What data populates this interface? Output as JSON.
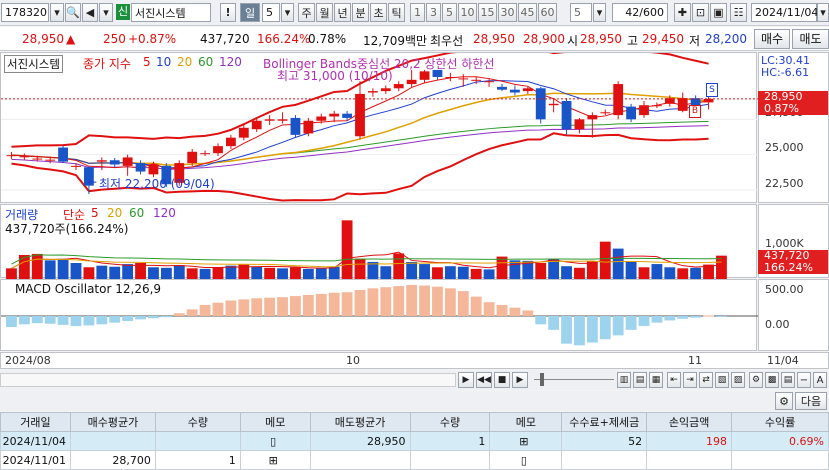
{
  "toolbar": {
    "code": "178320",
    "badge": "신",
    "name": "서진시스템",
    "excl": "!",
    "tf_sel": "일",
    "tf_num": "5",
    "tabs": [
      "주",
      "월",
      "년",
      "분",
      "초",
      "틱"
    ],
    "mins": [
      "1",
      "3",
      "5",
      "10",
      "15",
      "30",
      "45",
      "60"
    ],
    "min_val": "5",
    "count": "42/600",
    "date": "2024/11/04"
  },
  "quote": {
    "price": "28,950",
    "arrow": "▲",
    "change": "250",
    "rate": "+0.87%",
    "volume": "437,720",
    "vol_rate": "166.24%",
    "turnover": "0.78%",
    "amount": "12,709백만",
    "label_pri": "최우선",
    "ask": "28,950",
    "bid": "28,900",
    "open_lbl": "시",
    "open": "28,950",
    "high_lbl": "고",
    "high": "29,450",
    "low_lbl": "저",
    "low": "28,200",
    "buy": "매수",
    "sell": "매도"
  },
  "price_chart": {
    "name_tag": "서진시스템",
    "ma_title": "종가 지수",
    "ma_periods": [
      "5",
      "10",
      "20",
      "60",
      "120"
    ],
    "ma_colors": [
      "#e01010",
      "#2040d0",
      "#e0a000",
      "#2a9a2a",
      "#9030c0"
    ],
    "bb_text": "Bollinger Bands중심선 20,2  상한선  하한선",
    "max_note": "최고 31,000 (10/10)",
    "min_note": "최저 22,200 (09/04)",
    "lc": "LC:30.41",
    "hc": "HC:-6.61",
    "cur_price": "28,950",
    "cur_rate": "0.87%",
    "y_ticks": [
      "27,500",
      "25,000",
      "22,500"
    ]
  },
  "volume_chart": {
    "title": "거래량",
    "ma_title": "단순",
    "ma_periods": [
      "5",
      "20",
      "60",
      "120"
    ],
    "ma_colors": [
      "#e01010",
      "#e0a000",
      "#2a9a2a",
      "#9030c0"
    ],
    "sub": "437,720주(166.24%)",
    "y_tick": "1,000K",
    "cur": "437,720",
    "cur_rate": "166.24%"
  },
  "macd": {
    "title": "MACD Oscillator 12,26,9",
    "y_ticks": [
      "500.00",
      "0.00"
    ]
  },
  "date_axis": {
    "left": "2024/08",
    "mid": "10",
    "right": "11",
    "end": "11/04"
  },
  "chart_data": {
    "type": "candlestick",
    "candles": [
      {
        "o": 24960,
        "c": 24960,
        "h": 25180,
        "l": 24700
      },
      {
        "o": 24880,
        "c": 24880,
        "h": 25080,
        "l": 24620
      },
      {
        "o": 24720,
        "c": 24720,
        "h": 24920,
        "l": 24520
      },
      {
        "o": 24640,
        "c": 24640,
        "h": 24860,
        "l": 24380
      },
      {
        "o": 25500,
        "c": 24500,
        "h": 25640,
        "l": 24400
      },
      {
        "o": 24200,
        "c": 24200,
        "h": 24400,
        "l": 23900
      },
      {
        "o": 24100,
        "c": 22800,
        "h": 24200,
        "l": 22200
      },
      {
        "o": 24500,
        "c": 24600,
        "h": 24800,
        "l": 23900
      },
      {
        "o": 24600,
        "c": 24300,
        "h": 24760,
        "l": 24100
      },
      {
        "o": 24200,
        "c": 24800,
        "h": 25000,
        "l": 23500
      },
      {
        "o": 24400,
        "c": 23800,
        "h": 24600,
        "l": 23600
      },
      {
        "o": 23600,
        "c": 24300,
        "h": 24500,
        "l": 23400
      },
      {
        "o": 24200,
        "c": 22900,
        "h": 24400,
        "l": 22700
      },
      {
        "o": 23000,
        "c": 24400,
        "h": 24600,
        "l": 22800
      },
      {
        "o": 24400,
        "c": 25200,
        "h": 25400,
        "l": 24200
      },
      {
        "o": 25100,
        "c": 25100,
        "h": 25300,
        "l": 24900
      },
      {
        "o": 25100,
        "c": 25600,
        "h": 25800,
        "l": 24900
      },
      {
        "o": 25600,
        "c": 26200,
        "h": 26400,
        "l": 25400
      },
      {
        "o": 26200,
        "c": 26900,
        "h": 27100,
        "l": 26000
      },
      {
        "o": 26800,
        "c": 27400,
        "h": 27600,
        "l": 26600
      },
      {
        "o": 27400,
        "c": 27500,
        "h": 27800,
        "l": 27100
      },
      {
        "o": 27400,
        "c": 27500,
        "h": 28000,
        "l": 27200
      },
      {
        "o": 27600,
        "c": 26400,
        "h": 27800,
        "l": 26200
      },
      {
        "o": 26500,
        "c": 27400,
        "h": 27600,
        "l": 26300
      },
      {
        "o": 27400,
        "c": 27700,
        "h": 27900,
        "l": 27200
      },
      {
        "o": 27700,
        "c": 27900,
        "h": 28100,
        "l": 27300
      },
      {
        "o": 27900,
        "c": 27600,
        "h": 28100,
        "l": 27400
      },
      {
        "o": 26300,
        "c": 29300,
        "h": 30200,
        "l": 26100
      },
      {
        "o": 29400,
        "c": 29500,
        "h": 29700,
        "l": 29100
      },
      {
        "o": 29500,
        "c": 29700,
        "h": 29900,
        "l": 29300
      },
      {
        "o": 29700,
        "c": 30000,
        "h": 30200,
        "l": 29500
      },
      {
        "o": 30000,
        "c": 30300,
        "h": 31000,
        "l": 29800
      },
      {
        "o": 30300,
        "c": 30900,
        "h": 31000,
        "l": 30100
      },
      {
        "o": 31000,
        "c": 30500,
        "h": 31000,
        "l": 30300
      },
      {
        "o": 30500,
        "c": 30500,
        "h": 30800,
        "l": 30200
      },
      {
        "o": 30400,
        "c": 30400,
        "h": 30700,
        "l": 29800
      },
      {
        "o": 30300,
        "c": 30300,
        "h": 30500,
        "l": 30000
      },
      {
        "o": 30200,
        "c": 30200,
        "h": 30400,
        "l": 29800
      },
      {
        "o": 29800,
        "c": 29600,
        "h": 30000,
        "l": 29500
      },
      {
        "o": 29600,
        "c": 29400,
        "h": 29900,
        "l": 29200
      },
      {
        "o": 29500,
        "c": 29700,
        "h": 29800,
        "l": 29300
      },
      {
        "o": 29700,
        "c": 27500,
        "h": 29800,
        "l": 27200
      },
      {
        "o": 28500,
        "c": 28600,
        "h": 29000,
        "l": 28000
      },
      {
        "o": 28800,
        "c": 26800,
        "h": 29000,
        "l": 26400
      },
      {
        "o": 26800,
        "c": 27500,
        "h": 27600,
        "l": 26500
      },
      {
        "o": 27500,
        "c": 27800,
        "h": 28000,
        "l": 26200
      },
      {
        "o": 28000,
        "c": 28000,
        "h": 28200,
        "l": 27800
      },
      {
        "o": 27800,
        "c": 30000,
        "h": 30200,
        "l": 27500
      },
      {
        "o": 28400,
        "c": 27500,
        "h": 28600,
        "l": 27300
      },
      {
        "o": 27800,
        "c": 28500,
        "h": 28800,
        "l": 27600
      },
      {
        "o": 28500,
        "c": 28500,
        "h": 28700,
        "l": 28300
      },
      {
        "o": 28600,
        "c": 29000,
        "h": 29200,
        "l": 28400
      },
      {
        "o": 28100,
        "c": 29000,
        "h": 29400,
        "l": 28000
      },
      {
        "o": 29000,
        "c": 28400,
        "h": 29200,
        "l": 28200
      },
      {
        "o": 28700,
        "c": 28950,
        "h": 29450,
        "l": 28200
      }
    ],
    "volumes": [
      [
        200,
        "r"
      ],
      [
        450,
        "r"
      ],
      [
        470,
        "r"
      ],
      [
        350,
        "b"
      ],
      [
        380,
        "b"
      ],
      [
        300,
        "b"
      ],
      [
        220,
        "r"
      ],
      [
        250,
        "b"
      ],
      [
        230,
        "b"
      ],
      [
        280,
        "b"
      ],
      [
        300,
        "r"
      ],
      [
        220,
        "b"
      ],
      [
        210,
        "b"
      ],
      [
        260,
        "b"
      ],
      [
        200,
        "r"
      ],
      [
        190,
        "b"
      ],
      [
        220,
        "r"
      ],
      [
        250,
        "b"
      ],
      [
        270,
        "r"
      ],
      [
        230,
        "b"
      ],
      [
        210,
        "r"
      ],
      [
        200,
        "b"
      ],
      [
        220,
        "r"
      ],
      [
        190,
        "b"
      ],
      [
        200,
        "b"
      ],
      [
        230,
        "b"
      ],
      [
        1100,
        "r"
      ],
      [
        380,
        "r"
      ],
      [
        320,
        "b"
      ],
      [
        240,
        "b"
      ],
      [
        480,
        "r"
      ],
      [
        320,
        "b"
      ],
      [
        280,
        "b"
      ],
      [
        220,
        "r"
      ],
      [
        240,
        "b"
      ],
      [
        230,
        "b"
      ],
      [
        190,
        "r"
      ],
      [
        180,
        "b"
      ],
      [
        420,
        "r"
      ],
      [
        350,
        "b"
      ],
      [
        340,
        "b"
      ],
      [
        300,
        "r"
      ],
      [
        380,
        "b"
      ],
      [
        240,
        "b"
      ],
      [
        210,
        "r"
      ],
      [
        330,
        "r"
      ],
      [
        700,
        "r"
      ],
      [
        570,
        "b"
      ],
      [
        330,
        "b"
      ],
      [
        220,
        "r"
      ],
      [
        280,
        "b"
      ],
      [
        220,
        "b"
      ],
      [
        200,
        "r"
      ],
      [
        210,
        "b"
      ],
      [
        270,
        "r"
      ],
      [
        437.7,
        "r"
      ]
    ],
    "macd": [
      -200,
      -150,
      -130,
      -140,
      -160,
      -180,
      -170,
      -150,
      -120,
      -90,
      -60,
      -40,
      -20,
      50,
      120,
      200,
      240,
      280,
      300,
      320,
      330,
      340,
      360,
      380,
      400,
      420,
      430,
      470,
      500,
      520,
      540,
      560,
      550,
      530,
      500,
      450,
      350,
      250,
      200,
      150,
      100,
      -150,
      -250,
      -500,
      -530,
      -480,
      -420,
      -350,
      -250,
      -180,
      -120,
      -80,
      -50,
      -30,
      10,
      -10
    ],
    "y_range": [
      21500,
      32200
    ],
    "vol_range": [
      0,
      1200
    ],
    "macd_range": [
      -650,
      650
    ]
  },
  "table": {
    "headers": [
      "거래일",
      "매수평균가",
      "수량",
      "메모",
      "매도평균가",
      "수량",
      "메모",
      "수수료+제세금",
      "손익금액",
      "수익률"
    ],
    "rows": [
      {
        "date": "2024/11/04",
        "buy_avg": "",
        "buy_qty": "",
        "sell_avg": "28,950",
        "sell_qty": "1",
        "fee": "52",
        "pnl": "198",
        "ret": "0.69%"
      },
      {
        "date": "2024/11/01",
        "buy_avg": "28,700",
        "buy_qty": "1",
        "sell_avg": "",
        "sell_qty": "",
        "fee": "",
        "pnl": "",
        "ret": ""
      }
    ]
  },
  "footer": {
    "next": "다음"
  }
}
